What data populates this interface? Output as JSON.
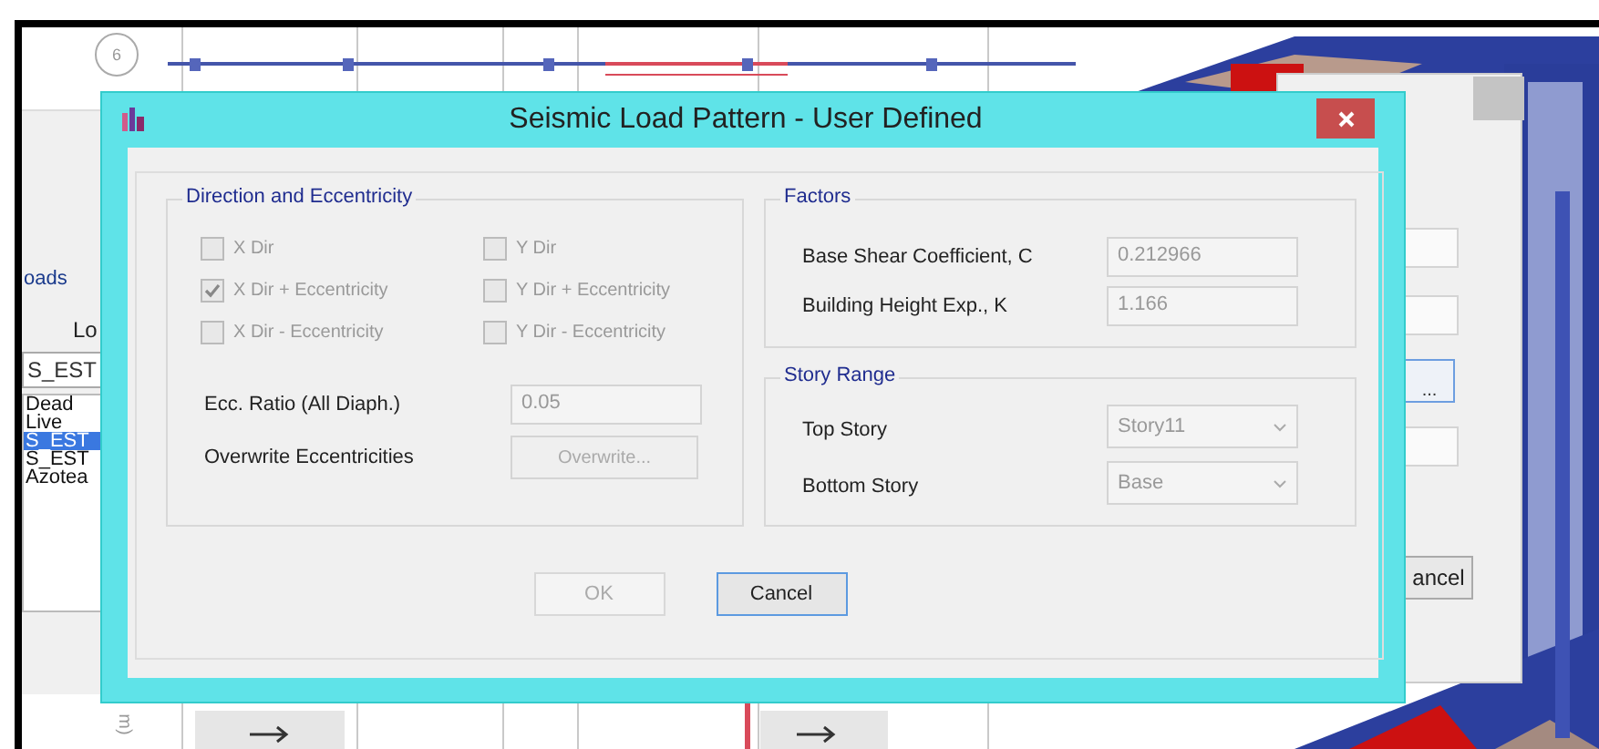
{
  "background": {
    "grid_bubble": "6",
    "axis_label": "m)"
  },
  "back_panel": {
    "heading": "oads",
    "label": "Lo",
    "field_value": "S_EST",
    "items": [
      {
        "label": "Dead",
        "selected": false
      },
      {
        "label": "Live",
        "selected": false
      },
      {
        "label": "S_EST",
        "selected": true
      },
      {
        "label": "S_EST",
        "selected": false
      },
      {
        "label": "Azotea",
        "selected": false
      }
    ]
  },
  "back_dialog": {
    "browse_button": "...",
    "cancel_button": "ancel"
  },
  "dialog": {
    "title": "Seismic Load Pattern - User Defined",
    "direction": {
      "title": "Direction and Eccentricity",
      "options": [
        {
          "label": "X Dir",
          "checked": false,
          "disabled": true
        },
        {
          "label": "Y Dir",
          "checked": false,
          "disabled": true
        },
        {
          "label": "X Dir + Eccentricity",
          "checked": true,
          "disabled": true
        },
        {
          "label": "Y Dir + Eccentricity",
          "checked": false,
          "disabled": true
        },
        {
          "label": "X Dir - Eccentricity",
          "checked": false,
          "disabled": true
        },
        {
          "label": "Y Dir - Eccentricity",
          "checked": false,
          "disabled": true
        }
      ],
      "ecc_ratio": {
        "label": "Ecc. Ratio (All Diaph.)",
        "value": "0.05"
      },
      "overwrite": {
        "label": "Overwrite Eccentricities",
        "button": "Overwrite..."
      }
    },
    "factors": {
      "title": "Factors",
      "rows": [
        {
          "label": "Base Shear Coefficient, C",
          "value": "0.212966"
        },
        {
          "label": "Building Height Exp., K",
          "value": "1.166"
        }
      ]
    },
    "story_range": {
      "title": "Story Range",
      "rows": [
        {
          "label": "Top Story",
          "value": "Story11"
        },
        {
          "label": "Bottom Story",
          "value": "Base"
        }
      ]
    },
    "buttons": [
      {
        "label": "OK",
        "disabled": true
      },
      {
        "label": "Cancel",
        "disabled": false
      }
    ]
  }
}
